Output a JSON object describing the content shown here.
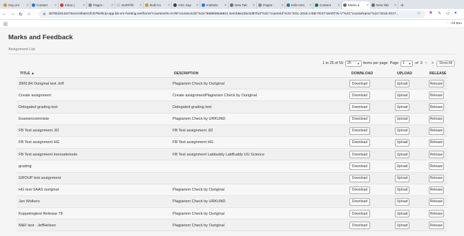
{
  "browser": {
    "tabs": [
      {
        "label": "Org Uni",
        "color": "#c79a2b"
      },
      {
        "label": "Contact",
        "color": "#2f6fd6"
      },
      {
        "label": "Inbox (",
        "color": "#d93025"
      },
      {
        "label": "Pages -",
        "color": "#8a8a8a"
      },
      {
        "label": "SURFfilr",
        "color": "#c9c9c9"
      },
      {
        "label": "Bulk Co",
        "color": "#c79a2b"
      },
      {
        "label": "ASC Sup",
        "color": "#3c3c3c"
      },
      {
        "label": "Institutic",
        "color": "#1a73e8"
      },
      {
        "label": "New Tab",
        "color": "#6b6b6b"
      },
      {
        "label": "Pages -",
        "color": "#8a8a8a"
      },
      {
        "label": "Edit Hom",
        "color": "#21759b"
      },
      {
        "label": "Content",
        "color": "#1f6e43"
      },
      {
        "label": "Marks a",
        "color": "#6b6b6b",
        "active": true
      },
      {
        "label": "New Tab",
        "color": "#6b6b6b"
      }
    ],
    "url": "4870bd414e2754cec9ba04cfc67f6ef6.lp-app.bb-xrn-hosting.net/home?courseUrls=%7B\"courseUUID\"%3A\"9589085a6811 4e4cb6e225c0d97fa3\"%2C\"courseId\"%3A\"SOL-2016-1-BB-TEST-MARTIN-V\"%2C\"courseName\"%3A\"2016-2017...",
    "all_bookmarks": "All Boo"
  },
  "page": {
    "title": "Marks and Feedback",
    "subheading": "Assignment List"
  },
  "pager": {
    "range": "1 to 25 of 59",
    "per_page_value": "25",
    "per_page_label": "items per page",
    "page_label": "Page",
    "page_value": "1",
    "of_label": "of",
    "total_pages": "3",
    "prev": "<",
    "next": ">",
    "show_all": "Show All"
  },
  "table": {
    "headers": {
      "title": "TITLE ▲",
      "description": "DESCRIPTION",
      "download": "DOWNLOAD",
      "upload": "UPLOAD",
      "release": "RELEASE"
    },
    "rows": [
      {
        "title": "3900.84 Ouriginal test Jeff",
        "description": "Plagiarism Check by Ouriginal"
      },
      {
        "title": "Create assignment",
        "description": "Create assignmentPlagiarism Check by Ouriginal"
      },
      {
        "title": "Delegated grading test",
        "description": "Delegated grading test"
      },
      {
        "title": "Examencommisie",
        "description": "Plagiarism Check by URKUND"
      },
      {
        "title": "FB Test assignment .82",
        "description": "FB Test assignment .82"
      },
      {
        "title": "FB Test assignment HG",
        "description": "FB Test assignment HG"
      },
      {
        "title": "FB Test assignment Innovatietools",
        "description": "FB Test assignment Labbuddy LabBuddy UU Science"
      },
      {
        "title": "grading",
        "description": ""
      },
      {
        "title": "GROUP test assignment",
        "description": ""
      },
      {
        "title": "HG test SAAS ouriginal",
        "description": "Plagiarism Check by Ouriginal"
      },
      {
        "title": "Jan Wolkers",
        "description": "Plagiarism Check by URKUND"
      },
      {
        "title": "Koppelingtest Release 78",
        "description": "Plagiarism Check by Ouriginal"
      },
      {
        "title": "M&F test - JeffHeleen",
        "description": "Plagiarism Check by Ouriginal"
      }
    ],
    "download_label": "Download",
    "upload_label": "Upload",
    "release_label": "Release"
  }
}
